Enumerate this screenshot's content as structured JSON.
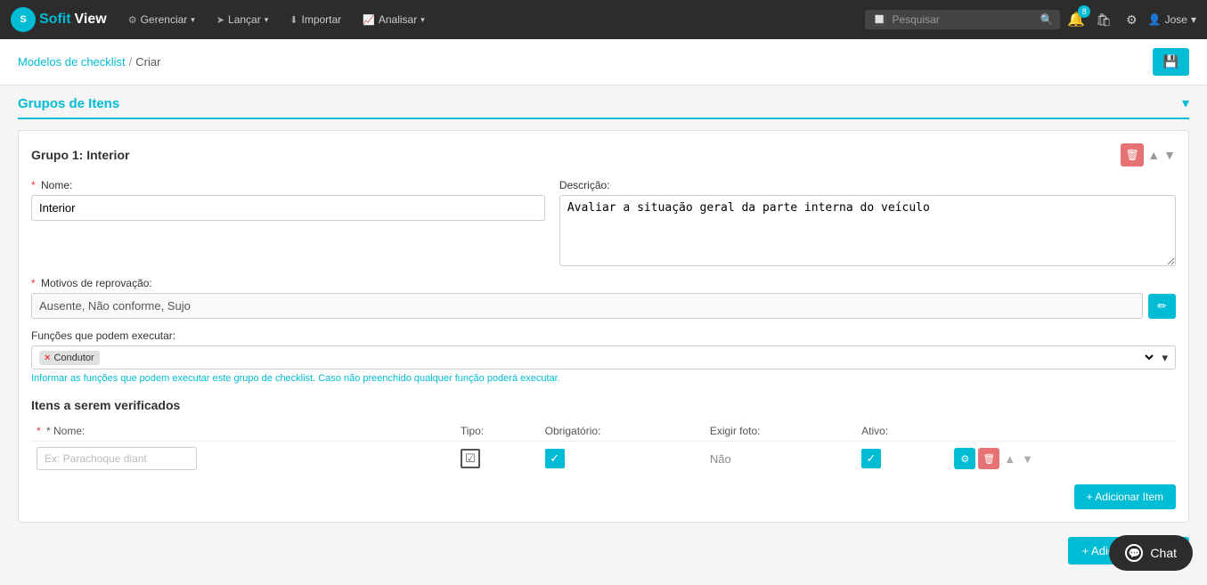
{
  "app": {
    "logo_sofit": "Sofit",
    "logo_view": "View"
  },
  "nav": {
    "items": [
      {
        "label": "Gerenciar",
        "icon": "⚙",
        "has_caret": true
      },
      {
        "label": "Lançar",
        "icon": "✈",
        "has_caret": true
      },
      {
        "label": "Importar",
        "icon": "📥",
        "has_caret": false
      },
      {
        "label": "Analisar",
        "icon": "📈",
        "has_caret": true
      }
    ]
  },
  "search": {
    "placeholder": "Pesquisar"
  },
  "notifications": {
    "badge": "8"
  },
  "user": {
    "name": "Jose"
  },
  "breadcrumb": {
    "link_label": "Modelos de checklist",
    "separator": "/",
    "current": "Criar"
  },
  "section": {
    "title": "Grupos de Itens"
  },
  "group": {
    "title": "Grupo 1: Interior",
    "name_label": "Nome:",
    "name_required": "*",
    "name_value": "Interior",
    "desc_label": "Descrição:",
    "desc_value": "Avaliar a situação geral da parte interna do veículo",
    "motivos_label": "Motivos de reprovação:",
    "motivos_required": "*",
    "motivos_value": "Ausente, Não conforme, Sujo",
    "funcoes_label": "Funções que podem executar:",
    "funcoes_tag": "Condutor",
    "funcoes_hint": "Informar as funções que podem executar este grupo de checklist. Caso não preenchido qualquer função poderá executar.",
    "itens_title": "Itens a serem verificados",
    "itens_headers": {
      "nome": "* Nome:",
      "tipo": "Tipo:",
      "obrigatorio": "Obrigatório:",
      "exigir_foto": "Exigir foto:",
      "ativo": "Ativo:"
    },
    "item_placeholder": "Ex: Parachoque diant",
    "item_exigir_foto": "Não",
    "add_item_btn": "+ Adicionar Item"
  },
  "add_group_btn": "+ Adicionar Grupo",
  "chat_label": "Chat"
}
